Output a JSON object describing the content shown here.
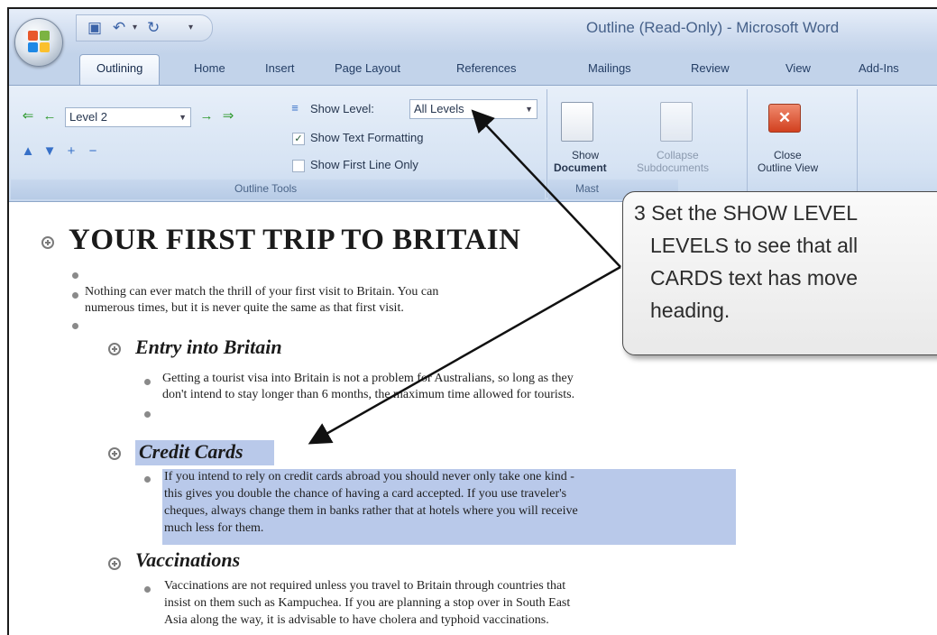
{
  "window": {
    "title": "Outline (Read-Only) - Microsoft Word"
  },
  "tabs": [
    {
      "label": "Outlining"
    },
    {
      "label": "Home"
    },
    {
      "label": "Insert"
    },
    {
      "label": "Page Layout"
    },
    {
      "label": "References"
    },
    {
      "label": "Mailings"
    },
    {
      "label": "Review"
    },
    {
      "label": "View"
    },
    {
      "label": "Add-Ins"
    }
  ],
  "ribbon": {
    "outline_tools": {
      "level_value": "Level 2",
      "show_level_label": "Show Level:",
      "show_level_value": "All Levels",
      "show_text_formatting": "Show Text Formatting",
      "show_text_formatting_checked": true,
      "show_first_line_only": "Show First Line Only",
      "show_first_line_only_checked": false,
      "group_label": "Outline Tools"
    },
    "master_document": {
      "show_document_line1": "Show",
      "show_document_line2": "Document",
      "collapse_line1": "Collapse",
      "collapse_line2": "Subdocuments",
      "group_label": "Mast"
    },
    "close": {
      "label_line1": "Close",
      "label_line2": "Outline View"
    }
  },
  "document": {
    "heading1": "YOUR FIRST TRIP TO BRITAIN",
    "intro_line1": "Nothing can ever match the thrill of your first visit to Britain.  You can",
    "intro_line2": "numerous times, but it is never quite the same as that first visit.",
    "sections": [
      {
        "heading": "Entry into Britain",
        "lines": [
          "Getting a tourist visa into Britain is not a problem for Australians, so long as they",
          "don't intend to stay longer than 6 months, the maximum time allowed for tourists."
        ]
      },
      {
        "heading": "Credit Cards",
        "lines": [
          "If you intend to rely on credit cards abroad you should never only take one kind -",
          "this gives you double the chance of having a card accepted.  If you use traveler's",
          "cheques, always change them in banks rather that at hotels where you will receive",
          "much less for them."
        ]
      },
      {
        "heading": "Vaccinations",
        "lines": [
          "Vaccinations are not required unless you travel to Britain through countries that",
          "insist on them such as Kampuchea. If you are planning a stop over in South East",
          "Asia along the way, it is advisable to have cholera and typhoid vaccinations."
        ]
      }
    ]
  },
  "callout": {
    "line1": "3  Set the SHOW LEVEL",
    "line2": "LEVELS to see that all",
    "line3": "CARDS text has move",
    "line4": "heading."
  },
  "colors": {
    "selection_highlight": "#b9c9ea",
    "ribbon_blue": "#c2d3ea"
  }
}
